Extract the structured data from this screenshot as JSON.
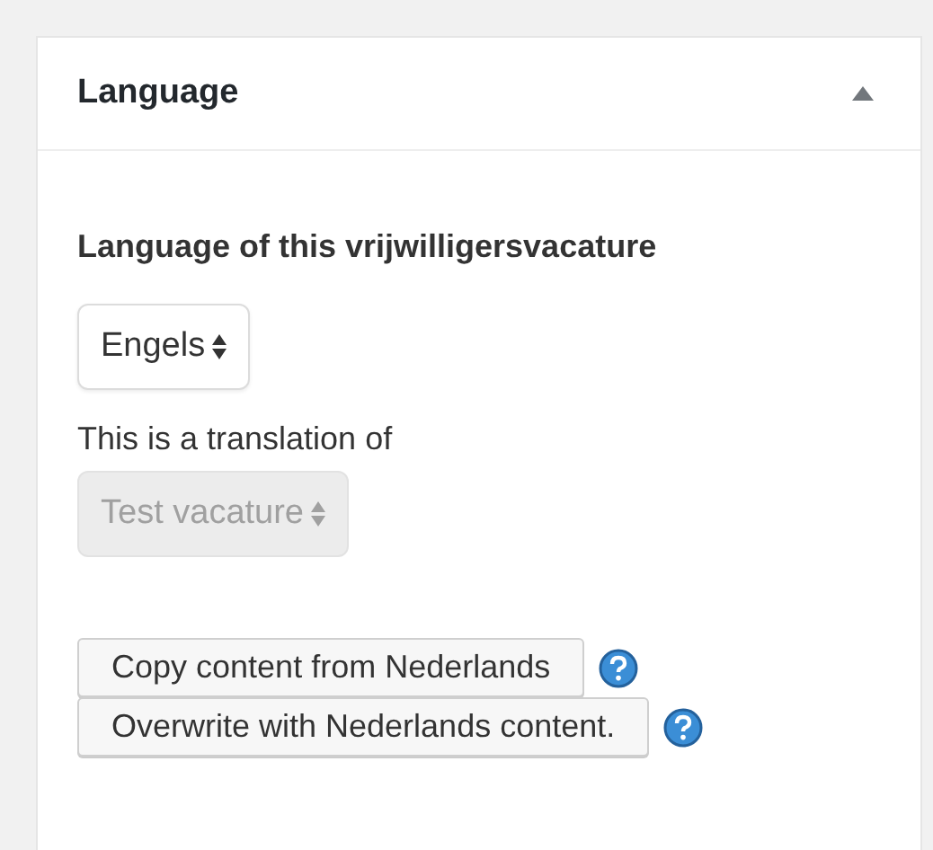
{
  "panel": {
    "title": "Language",
    "expanded": true
  },
  "language_field": {
    "label": "Language of this vrijwilligersvacature",
    "value": "Engels",
    "disabled": false
  },
  "translation_field": {
    "label": "This is a translation of",
    "value": "Test vacature",
    "disabled": true
  },
  "buttons": [
    {
      "label": "Copy content from Nederlands"
    },
    {
      "label": "Overwrite with Nederlands content."
    }
  ]
}
